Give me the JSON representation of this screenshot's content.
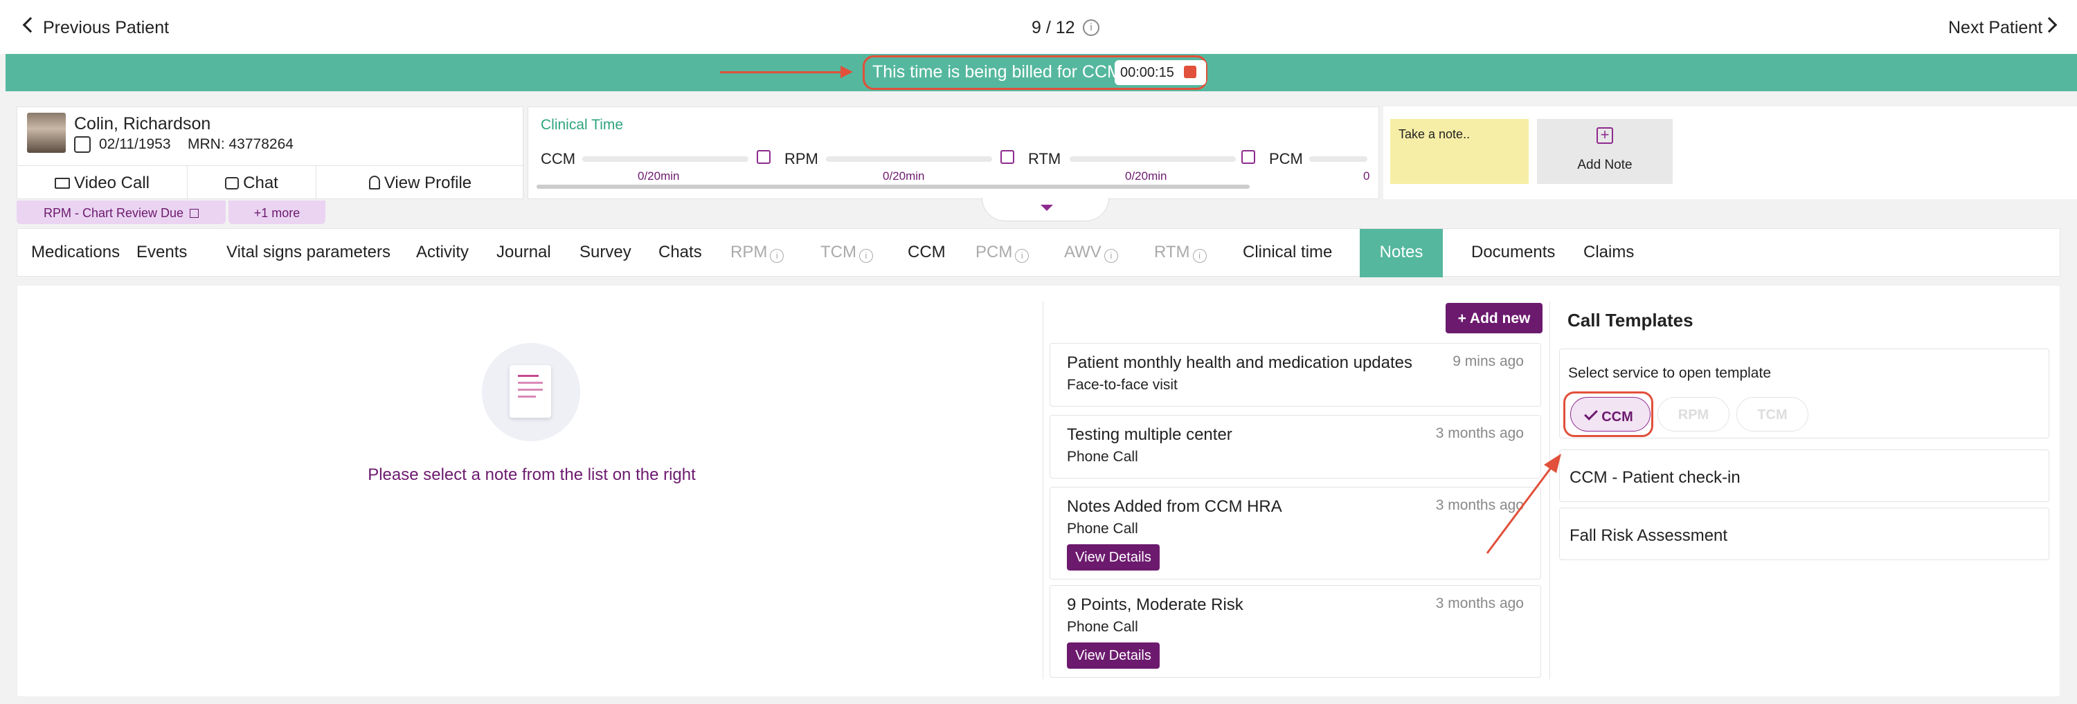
{
  "nav": {
    "prev": "Previous Patient",
    "counter": "9 / 12",
    "next": "Next Patient"
  },
  "billing": {
    "text": "This time is being billed for CCM",
    "timer": "00:00:15"
  },
  "patient": {
    "name": "Colin, Richardson",
    "dob": "02/11/1953",
    "mrn": "MRN: 43778264",
    "buttons": {
      "video": "Video Call",
      "chat": "Chat",
      "profile": "View Profile"
    },
    "badge": "RPM - Chart Review Due",
    "more": "+1 more"
  },
  "clinical_time": {
    "title": "Clinical Time",
    "items": [
      {
        "label": "CCM",
        "value": "0/20min"
      },
      {
        "label": "RPM",
        "value": "0/20min"
      },
      {
        "label": "RTM",
        "value": "0/20min"
      },
      {
        "label": "PCM",
        "value": "0"
      }
    ]
  },
  "notes_widget": {
    "sticky": "Take a note..",
    "add": "Add Note"
  },
  "tabs": [
    "Medications",
    "Events",
    "Vital signs parameters",
    "Activity",
    "Journal",
    "Survey",
    "Chats",
    "RPM",
    "TCM",
    "CCM",
    "PCM",
    "AWV",
    "RTM",
    "Clinical time",
    "Notes",
    "Documents",
    "Claims"
  ],
  "empty_message": "Please select a note from the list on the right",
  "add_new": "+ Add new",
  "notes": [
    {
      "title": "Patient monthly health and medication updates",
      "time": "9 mins ago",
      "type": "Face-to-face visit"
    },
    {
      "title": "Testing multiple center",
      "time": "3 months ago",
      "type": "Phone Call"
    },
    {
      "title": "Notes Added from CCM HRA",
      "time": "3 months ago",
      "type": "Phone Call",
      "action": "View Details"
    },
    {
      "title": "9 Points, Moderate Risk",
      "time": "3 months ago",
      "type": "Phone Call",
      "action": "View Details"
    }
  ],
  "call_templates": {
    "title": "Call Templates",
    "select_label": "Select service to open template",
    "services": [
      "CCM",
      "RPM",
      "TCM"
    ],
    "items": [
      "CCM - Patient check-in",
      "Fall Risk Assessment"
    ]
  },
  "colors": {
    "teal": "#55b89e",
    "purple": "#6c1a6e",
    "highlight": "#e1503a"
  }
}
